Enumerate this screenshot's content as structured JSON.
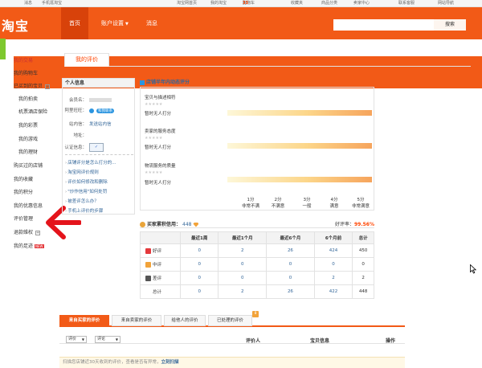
{
  "topbar": {
    "left": [
      "消息",
      "手机逛淘宝"
    ],
    "right": [
      "淘宝网首页",
      "我的淘宝"
    ],
    "cart_label": "购物车",
    "cart_count": "33",
    "cart_suffix": "",
    "more": [
      "收藏夹",
      "商品分类",
      "卖家中心",
      "联系客服",
      "网站导航"
    ]
  },
  "header": {
    "logo": "淘宝",
    "nav": [
      "首页",
      "账户设置",
      "消息"
    ],
    "search_placeholder": "",
    "search_button": "搜索"
  },
  "sidebar": {
    "items": [
      {
        "label": "我的交易",
        "sub": false,
        "header": true
      },
      {
        "label": "我的购物车",
        "sub": false
      },
      {
        "label": "已买到的宝贝",
        "sub": false,
        "plus": "+"
      },
      {
        "label": "我的拍卖",
        "sub": true
      },
      {
        "label": "机票酒店保险",
        "sub": true
      },
      {
        "label": "我的彩票",
        "sub": true
      },
      {
        "label": "我的游戏",
        "sub": true
      },
      {
        "label": "我的理财",
        "sub": true
      },
      {
        "label": "购买过的店铺",
        "sub": false
      },
      {
        "label": "我的收藏",
        "sub": false
      },
      {
        "label": "我的积分",
        "sub": false
      },
      {
        "label": "我的优惠信息",
        "sub": false
      },
      {
        "label": "评价管理",
        "sub": false
      },
      {
        "label": "退款维权",
        "sub": false,
        "plus": "+"
      },
      {
        "label": "我的足迹",
        "sub": false,
        "new": "NEW"
      }
    ]
  },
  "main_tab": "我的评价",
  "personal_info": {
    "title": "个人信息",
    "member_label": "会员名：",
    "wangwang_label": "阿里旺旺：",
    "wangwang_value": "和我联系",
    "mail_label": "站内信：",
    "mail_value": "发送站内信",
    "address_label": "地址：",
    "cert_label": "认证信息：",
    "links": [
      "店铺评分是怎么打分的...",
      "淘宝网评价规则",
      "评价如何修改和删除",
      "\"炒作信用\"如何处罚",
      "被差评怎么办？",
      "手机上评价的步骤"
    ]
  },
  "shop_rating": {
    "title": "店铺半年内动态评分",
    "items": [
      {
        "label": "宝贝与描述相符",
        "stars": "★★★★★",
        "noscore": "暂时无人打分"
      },
      {
        "label": "卖家的服务态度",
        "stars": "★★★★★",
        "noscore": "暂时无人打分"
      },
      {
        "label": "物流服务的质量",
        "stars": "★★★★★",
        "noscore": "暂时无人打分"
      }
    ],
    "scale": [
      {
        "score": "1分",
        "desc": "非常不满"
      },
      {
        "score": "2分",
        "desc": "不满意"
      },
      {
        "score": "3分",
        "desc": "一般"
      },
      {
        "score": "4分",
        "desc": "满意"
      },
      {
        "score": "5分",
        "desc": "非常满意"
      }
    ]
  },
  "buyer_credit": {
    "label": "买家累积信用：",
    "value": "448",
    "good_rate_label": "好评率：",
    "good_rate_value": "99.56%"
  },
  "credit_table": {
    "headers": [
      "",
      "最近1周",
      "最近1个月",
      "最近6个月",
      "6个月前",
      "总计"
    ],
    "rows": [
      {
        "label": "好评",
        "icon_color": "#e4393c",
        "values": [
          "0",
          "2",
          "26",
          "424",
          "450"
        ]
      },
      {
        "label": "中评",
        "icon_color": "#f2a33a",
        "values": [
          "0",
          "0",
          "0",
          "0",
          "0"
        ]
      },
      {
        "label": "差评",
        "icon_color": "#555555",
        "values": [
          "0",
          "0",
          "0",
          "2",
          "2"
        ]
      },
      {
        "label": "总计",
        "icon_color": "",
        "values": [
          "0",
          "2",
          "26",
          "422",
          "448"
        ]
      }
    ]
  },
  "review_tabs": [
    "来自买家的评价",
    "来自卖家的评价",
    "给他人的评价",
    "已处理的评价"
  ],
  "review_badge": "8",
  "filters": {
    "select1": "评价",
    "select2": "评论",
    "columns": [
      "评价人",
      "宝贝信息",
      "操作"
    ]
  },
  "notice": {
    "text": "扫描您店铺近30天收到的评价，查看是否有异常，",
    "link": "立刻扫描"
  }
}
